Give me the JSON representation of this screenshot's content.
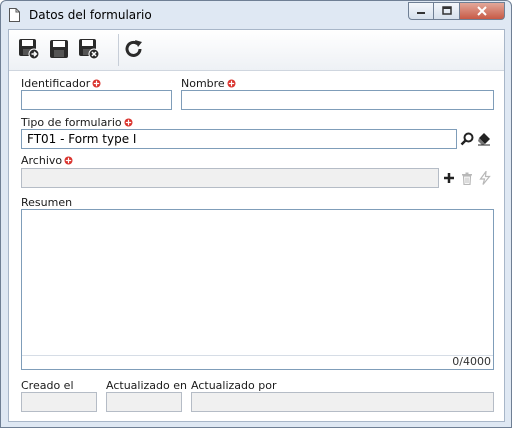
{
  "window": {
    "title": "Datos del formulario",
    "minimize_icon": "minimize-icon",
    "maximize_icon": "maximize-icon",
    "close_icon": "close-icon"
  },
  "toolbar": {
    "buttons": [
      {
        "name": "save-new-button",
        "icon": "save-new-icon"
      },
      {
        "name": "save-button",
        "icon": "save-icon"
      },
      {
        "name": "save-close-button",
        "icon": "save-close-icon"
      },
      {
        "name": "refresh-button",
        "icon": "refresh-icon"
      }
    ]
  },
  "form": {
    "identificador": {
      "label": "Identificador",
      "value": ""
    },
    "nombre": {
      "label": "Nombre",
      "value": ""
    },
    "tipo": {
      "label": "Tipo de formulario",
      "value": "FT01 - Form type I"
    },
    "archivo": {
      "label": "Archivo",
      "value": ""
    },
    "resumen": {
      "label": "Resumen",
      "value": "",
      "counter": "0/4000"
    },
    "creado": {
      "label": "Creado el",
      "value": ""
    },
    "actualizado_en": {
      "label": "Actualizado en",
      "value": ""
    },
    "actualizado_por": {
      "label": "Actualizado por",
      "value": ""
    }
  },
  "colors": {
    "required_marker": "#d9302a",
    "accent": "#7f9db9"
  }
}
